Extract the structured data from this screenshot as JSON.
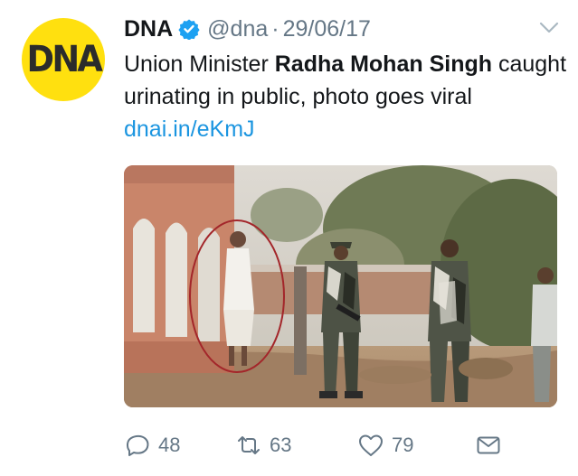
{
  "tweet": {
    "avatar_text": "DNA",
    "name": "DNA",
    "handle": "@dna",
    "separator": "·",
    "date": "29/06/17",
    "text_prefix": "Union Minister ",
    "text_bold": "Radha Mohan Singh",
    "text_suffix": " caught urinating in public, photo goes viral ",
    "link": "dnai.in/eKmJ"
  },
  "actions": {
    "reply_count": "48",
    "retweet_count": "63",
    "like_count": "79"
  },
  "icons": [
    "verified-badge-icon",
    "chevron-down-icon",
    "reply-icon",
    "retweet-icon",
    "like-icon",
    "direct-message-icon"
  ],
  "colors": {
    "avatar_bg": "#ffe00f",
    "link": "#1b95e0",
    "verified": "#1da1f2",
    "muted": "#657786"
  }
}
